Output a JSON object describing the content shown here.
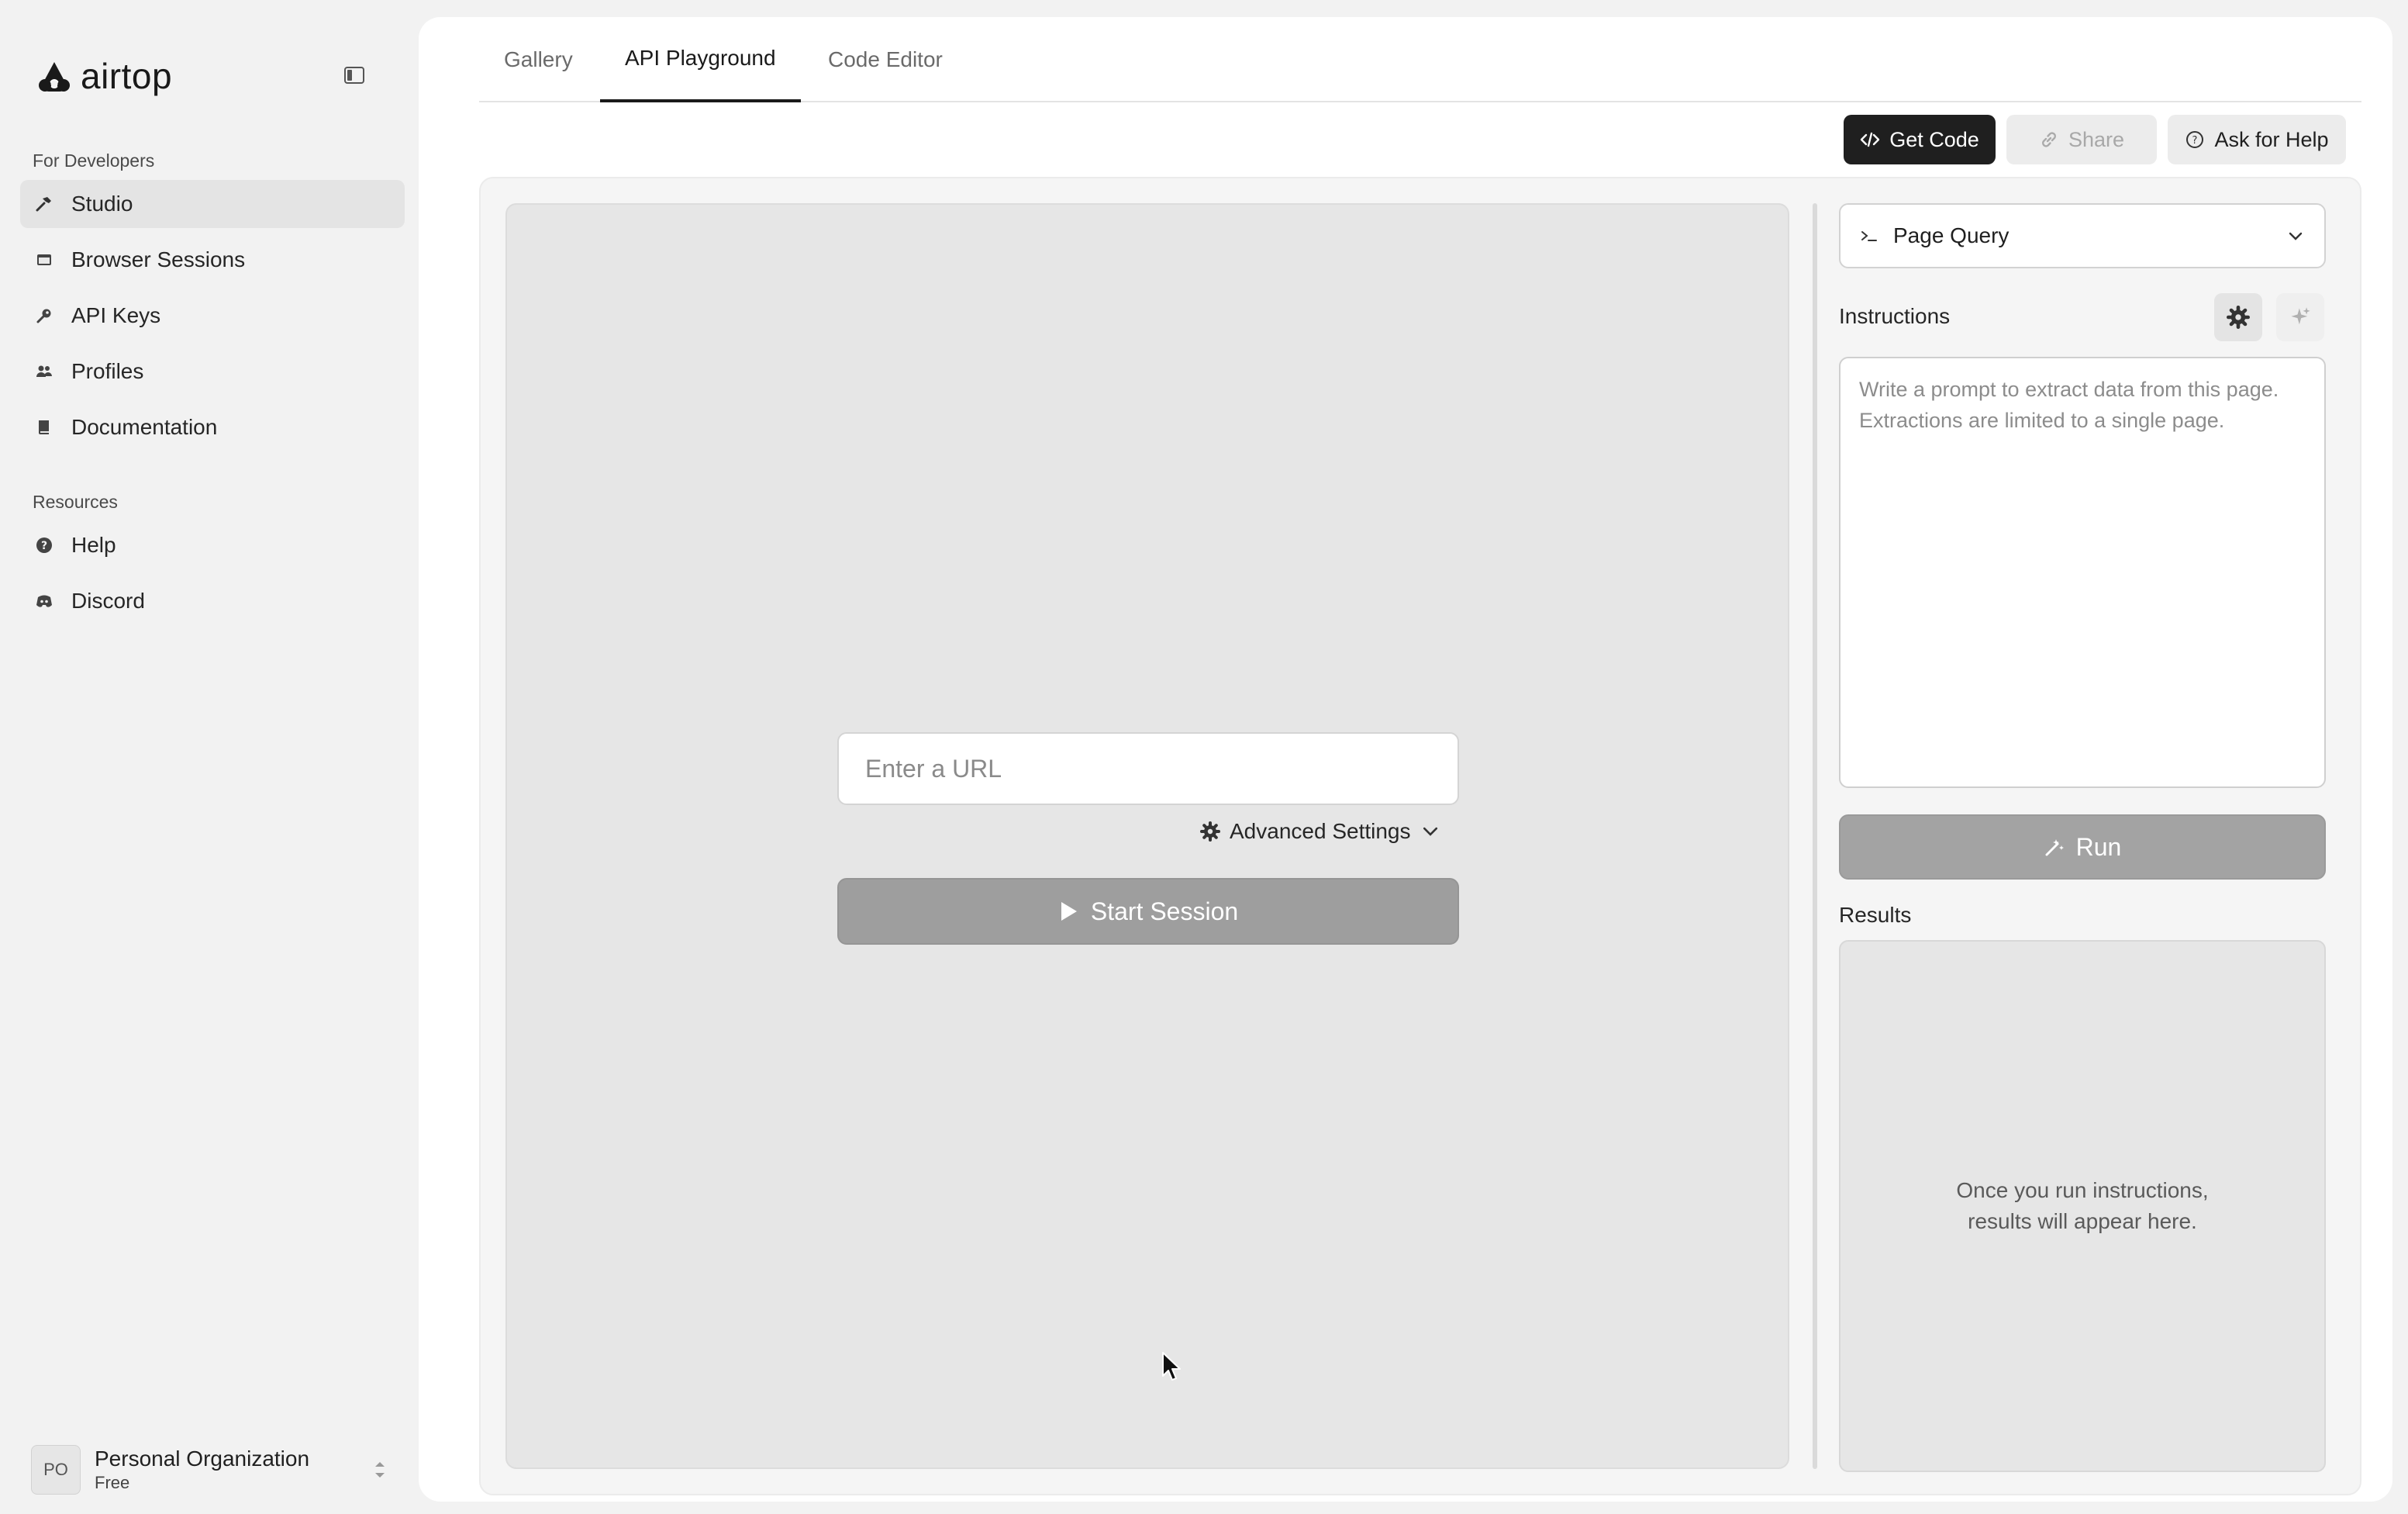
{
  "sidebar": {
    "logo_text": "airtop",
    "sections": [
      {
        "label": "For Developers",
        "items": [
          {
            "label": "Studio",
            "icon": "hammer-icon",
            "active": true
          },
          {
            "label": "Browser Sessions",
            "icon": "browser-icon",
            "active": false
          },
          {
            "label": "API Keys",
            "icon": "key-icon",
            "active": false
          },
          {
            "label": "Profiles",
            "icon": "users-icon",
            "active": false
          },
          {
            "label": "Documentation",
            "icon": "book-icon",
            "active": false
          }
        ]
      },
      {
        "label": "Resources",
        "items": [
          {
            "label": "Help",
            "icon": "help-circle-icon",
            "active": false
          },
          {
            "label": "Discord",
            "icon": "discord-icon",
            "active": false
          }
        ]
      }
    ],
    "org": {
      "initials": "PO",
      "name": "Personal Organization",
      "plan": "Free"
    }
  },
  "tabs": [
    {
      "label": "Gallery",
      "active": false
    },
    {
      "label": "API Playground",
      "active": true
    },
    {
      "label": "Code Editor",
      "active": false
    }
  ],
  "toolbar": {
    "get_code_label": "Get Code",
    "share_label": "Share",
    "ask_help_label": "Ask for Help"
  },
  "session": {
    "url_placeholder": "Enter a URL",
    "advanced_settings_label": "Advanced Settings",
    "start_label": "Start Session"
  },
  "query": {
    "mode_label": "Page Query",
    "instructions_label": "Instructions",
    "prompt_placeholder": "Write a prompt to extract data from this page. Extractions are limited to a single page.",
    "run_label": "Run",
    "results_label": "Results",
    "results_empty": "Once you run instructions, results will appear here."
  },
  "colors": {
    "primary_dark": "#1f1f1f",
    "disabled_button": "#9e9e9e",
    "panel_bg": "#e6e6e6",
    "active_nav_bg": "#e4e4e4"
  }
}
